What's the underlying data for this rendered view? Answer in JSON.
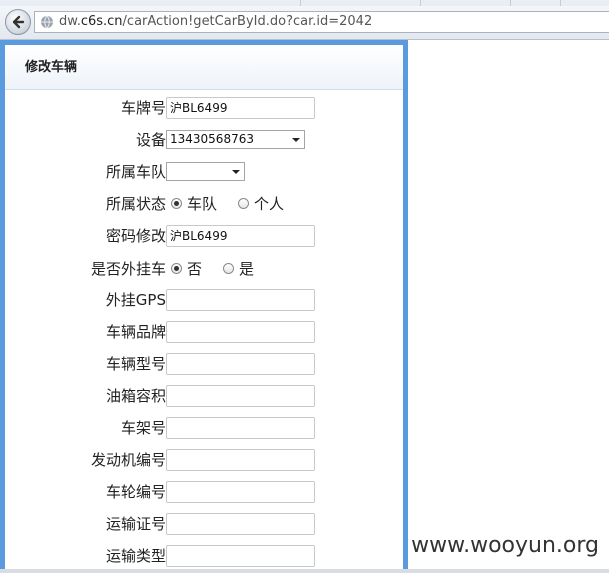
{
  "browser": {
    "url_prefix": "dw.",
    "url_domain": "c6s.cn",
    "url_path": "/carAction!getCarById.do?car.id=2042",
    "back_icon": "back-arrow-icon",
    "site_icon": "globe-icon"
  },
  "panel": {
    "title": "修改车辆"
  },
  "form": {
    "plate": {
      "label": "车牌号",
      "value": "沪BL6499"
    },
    "device": {
      "label": "设备",
      "value": "13430568763"
    },
    "fleet": {
      "label": "所属车队",
      "value": ""
    },
    "ownership": {
      "label": "所属状态",
      "options": [
        "车队",
        "个人"
      ],
      "selected": "车队"
    },
    "password": {
      "label": "密码修改",
      "value": "沪BL6499"
    },
    "external": {
      "label": "是否外挂车",
      "options": [
        "否",
        "是"
      ],
      "selected": "否"
    },
    "ext_gps": {
      "label": "外挂GPS",
      "value": ""
    },
    "brand": {
      "label": "车辆品牌",
      "value": ""
    },
    "model": {
      "label": "车辆型号",
      "value": ""
    },
    "tank": {
      "label": "油箱容积",
      "value": ""
    },
    "frame_no": {
      "label": "车架号",
      "value": ""
    },
    "engine_no": {
      "label": "发动机编号",
      "value": ""
    },
    "wheel_no": {
      "label": "车轮编号",
      "value": ""
    },
    "transport_cert": {
      "label": "运输证号",
      "value": ""
    },
    "transport_type": {
      "label": "运输类型",
      "value": ""
    }
  },
  "watermark": "www.wooyun.org",
  "colors": {
    "frame": "#5a9be0",
    "header_bg": "#eef3f9"
  }
}
